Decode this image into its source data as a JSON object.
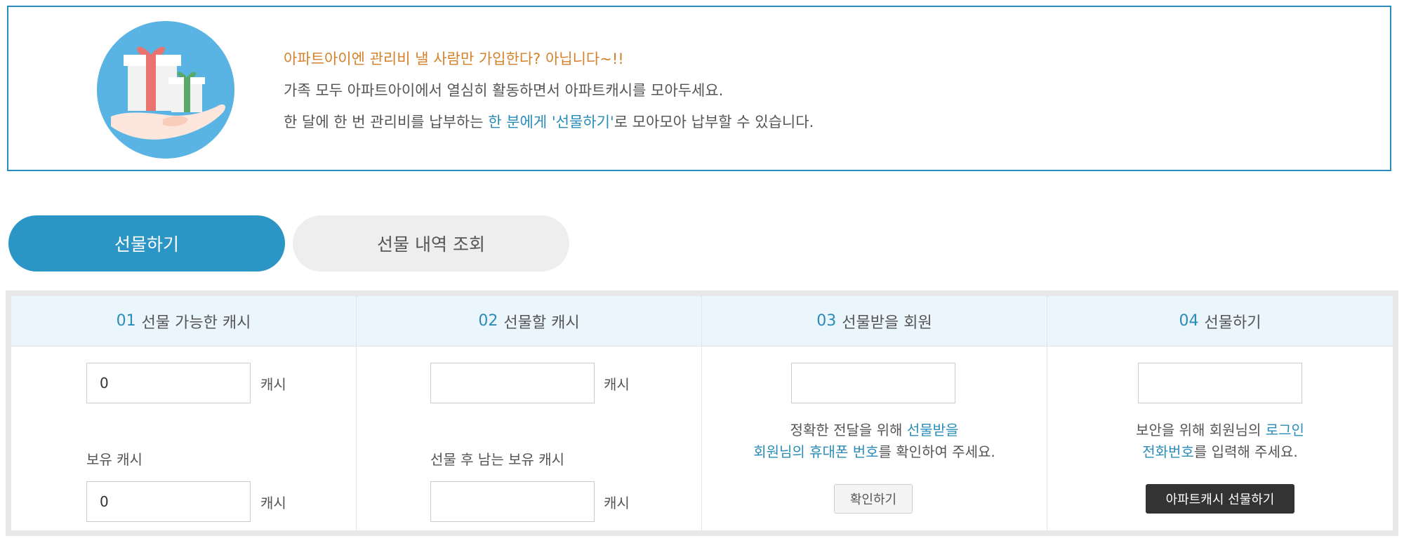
{
  "banner": {
    "line1": "아파트아이엔 관리비 낼 사람만 가입한다? 아닙니다~!!",
    "line2": "가족 모두 아파트아이에서 열심히 활동하면서 아파트캐시를 모아두세요.",
    "line3_pre": "한 달에 한 번 관리비를 납부하는 ",
    "line3_hl": "한 분에게 '선물하기'",
    "line3_post": "로 모아모아 납부할 수 있습니다."
  },
  "tabs": [
    {
      "label": "선물하기",
      "active": true
    },
    {
      "label": "선물 내역 조회",
      "active": false
    }
  ],
  "steps": [
    {
      "num": "01",
      "title": "선물 가능한 캐시",
      "input_value": "0",
      "unit": "캐시",
      "sub_label": "보유 캐시",
      "sub_value": "0",
      "sub_unit": "캐시"
    },
    {
      "num": "02",
      "title": "선물할 캐시",
      "input_value": "",
      "unit": "캐시",
      "sub_label": "선물 후 남는 보유 캐시",
      "sub_value": "",
      "sub_unit": "캐시"
    },
    {
      "num": "03",
      "title": "선물받을 회원",
      "input_value": "",
      "note_pre": "정확한 전달을 위해 ",
      "note_hl1": "선물받을",
      "note_hl2": "회원님의 휴대폰 번호",
      "note_post": "를 확인하여 주세요.",
      "button": "확인하기"
    },
    {
      "num": "04",
      "title": "선물하기",
      "input_value": "",
      "note_pre": "보안을 위해 회원님의 ",
      "note_hl1": "로그인",
      "note_hl2": "전화번호",
      "note_post": "를 입력해 주세요.",
      "button": "아파트캐시 선물하기"
    }
  ],
  "colors": {
    "accent": "#2a8cb8",
    "tab_active": "#2b96c6",
    "banner_highlight": "#d4812a",
    "header_bg": "#eaf5fc",
    "dark_button": "#333333"
  },
  "icons": {
    "banner": "gift-in-hand-icon"
  }
}
